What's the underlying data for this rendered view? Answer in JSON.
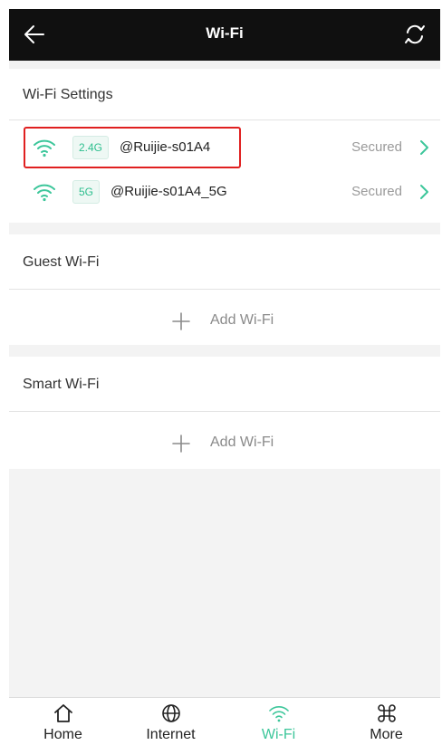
{
  "header": {
    "title": "Wi-Fi",
    "back_icon": "arrow-left-icon",
    "refresh_icon": "refresh-icon"
  },
  "wifi_settings": {
    "title": "Wi-Fi Settings",
    "networks": [
      {
        "band": "2.4G",
        "ssid": "@Ruijie-s01A4",
        "status": "Secured",
        "highlighted": true
      },
      {
        "band": "5G",
        "ssid": "@Ruijie-s01A4_5G",
        "status": "Secured",
        "highlighted": false
      }
    ]
  },
  "guest_wifi": {
    "title": "Guest Wi-Fi",
    "add_label": "Add Wi-Fi"
  },
  "smart_wifi": {
    "title": "Smart Wi-Fi",
    "add_label": "Add Wi-Fi"
  },
  "tabbar": {
    "items": [
      {
        "label": "Home",
        "icon": "home-icon",
        "active": false
      },
      {
        "label": "Internet",
        "icon": "globe-icon",
        "active": false
      },
      {
        "label": "Wi-Fi",
        "icon": "wifi-icon",
        "active": true
      },
      {
        "label": "More",
        "icon": "command-icon",
        "active": false
      }
    ]
  },
  "colors": {
    "accent": "#3cc69a",
    "header_bg": "#101010",
    "highlight_border": "#e02020"
  }
}
